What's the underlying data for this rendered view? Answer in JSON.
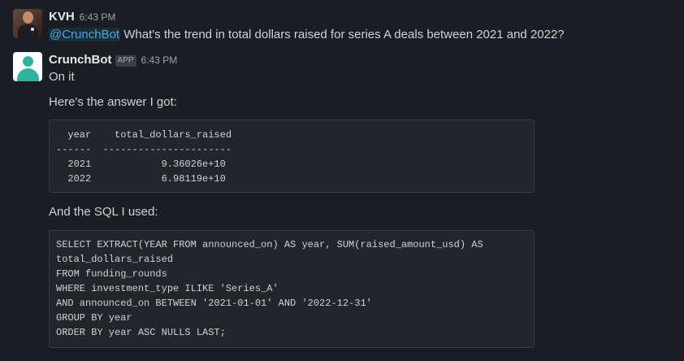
{
  "messages": [
    {
      "author": "KVH",
      "time": "6:43 PM",
      "mention": "@CrunchBot",
      "text": " What's the trend in total dollars raised for series A deals between 2021 and 2022?"
    },
    {
      "author": "CrunchBot",
      "badge": "APP",
      "time": "6:43 PM",
      "line1": "On it",
      "line2": "Here's the answer I got:",
      "result_table": "  year    total_dollars_raised\n------  ----------------------\n  2021            9.36026e+10\n  2022            6.98119e+10",
      "line3": "And the SQL I used:",
      "sql": "SELECT EXTRACT(YEAR FROM announced_on) AS year, SUM(raised_amount_usd) AS\ntotal_dollars_raised\nFROM funding_rounds\nWHERE investment_type ILIKE 'Series_A'\nAND announced_on BETWEEN '2021-01-01' AND '2022-12-31'\nGROUP BY year\nORDER BY year ASC NULLS LAST;"
    }
  ],
  "colors": {
    "background": "#1a1d21",
    "mention": "#4fa3e0",
    "bot_avatar": "#2bb5a0"
  }
}
